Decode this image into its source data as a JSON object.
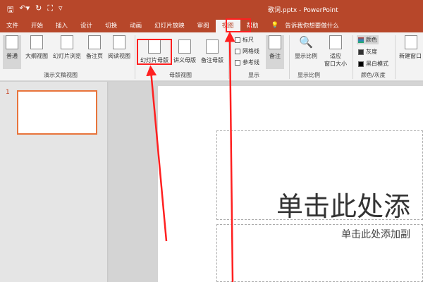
{
  "titlebar": {
    "title": "歌词.pptx - PowerPoint",
    "qat": [
      "save-icon",
      "undo-icon",
      "redo-icon",
      "present-icon",
      "customize-icon"
    ]
  },
  "tabs": [
    "文件",
    "开始",
    "插入",
    "设计",
    "切换",
    "动画",
    "幻灯片放映",
    "审阅",
    "视图",
    "帮助",
    "告诉我你想要做什么"
  ],
  "ribbon": {
    "presentation_views": [
      "普通",
      "大纲视图",
      "幻灯片浏览",
      "备注页",
      "阅读视图"
    ],
    "presentation_views_group": "演示文稿视图",
    "master_views": [
      "幻灯片母版",
      "讲义母版",
      "备注母版"
    ],
    "master_views_group": "母版视图",
    "show": [
      "标尺",
      "网格线",
      "参考线"
    ],
    "notes": "备注",
    "show_group": "显示",
    "zoom": "显示比例",
    "fit": "适应",
    "fit2": "窗口大小",
    "zoom_group": "显示比例",
    "color": [
      "颜色",
      "灰度",
      "黑白模式"
    ],
    "color_group": "颜色/灰度",
    "new_window": "新建窗口"
  },
  "slides_panel": {
    "number": "1"
  },
  "slide": {
    "title_placeholder": "单击此处添",
    "subtitle_placeholder": "单击此处添加副"
  },
  "colors": {
    "accent": "#b7472a",
    "annotation": "#ff2020"
  }
}
